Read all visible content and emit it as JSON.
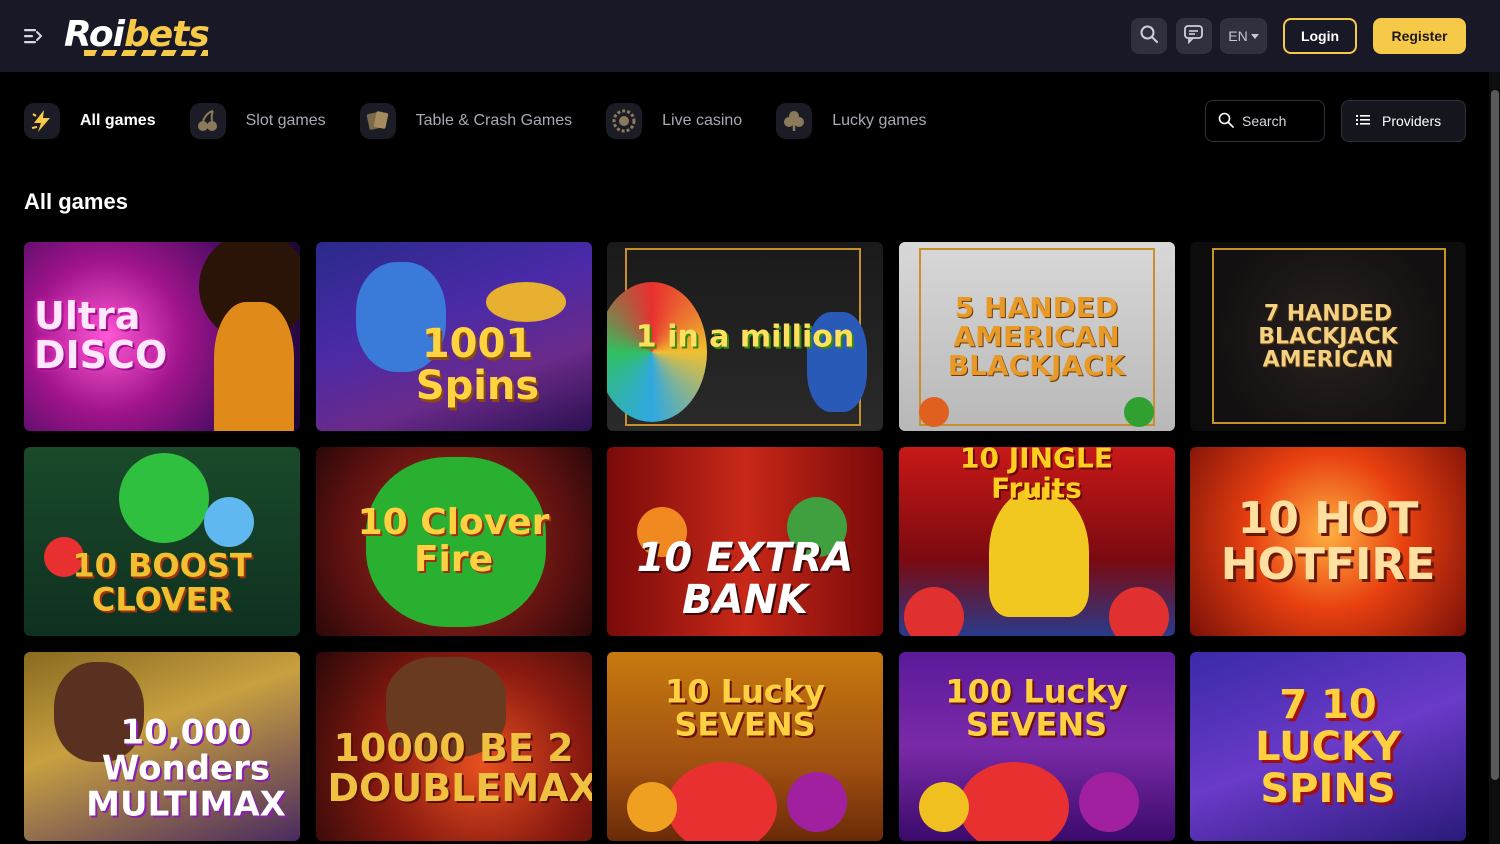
{
  "header": {
    "logo_text_a": "Roi",
    "logo_text_b": "bets",
    "lang": "EN",
    "login_label": "Login",
    "register_label": "Register",
    "icons": [
      "menu-icon",
      "search-icon",
      "chat-icon",
      "chevron-down-icon"
    ]
  },
  "categories": [
    {
      "label": "All games",
      "icon": "lightning-icon",
      "active": true
    },
    {
      "label": "Slot games",
      "icon": "cherries-icon",
      "active": false
    },
    {
      "label": "Table & Crash Games",
      "icon": "cards-icon",
      "active": false
    },
    {
      "label": "Live casino",
      "icon": "roulette-icon",
      "active": false
    },
    {
      "label": "Lucky games",
      "icon": "clover-icon",
      "active": false
    }
  ],
  "search": {
    "placeholder": "Search"
  },
  "providers_label": "Providers",
  "section_title": "All games",
  "games": [
    {
      "title": "Ultra DISCO"
    },
    {
      "title": "1001 Spins"
    },
    {
      "title": "1 in a million"
    },
    {
      "title": "5 HANDED AMERICAN BLACKJACK"
    },
    {
      "title": "7 HANDED BLACKJACK AMERICAN"
    },
    {
      "title": "10 BOOST CLOVER"
    },
    {
      "title": "10 Clover Fire"
    },
    {
      "title": "10 EXTRA BANK"
    },
    {
      "title": "10 JINGLE Fruits"
    },
    {
      "title": "10 HOT HOTFIRE"
    },
    {
      "title": "10,000 Wonders MULTIMAX"
    },
    {
      "title": "10000 BE 2 DOUBLEMAX"
    },
    {
      "title": "10 Lucky SEVENS"
    },
    {
      "title": "100 Lucky SEVENS"
    },
    {
      "title": "7 10 LUCKY SPINS"
    }
  ],
  "colors": {
    "accent": "#f7c948",
    "header_bg": "#181826",
    "page_bg": "#000000"
  }
}
